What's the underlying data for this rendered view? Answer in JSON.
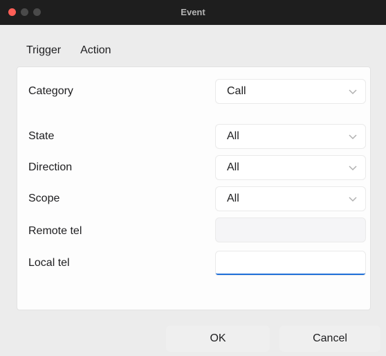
{
  "window": {
    "title": "Event"
  },
  "tabs": [
    {
      "label": "Trigger"
    },
    {
      "label": "Action"
    }
  ],
  "fields": {
    "category": {
      "label": "Category",
      "value": "Call"
    },
    "state": {
      "label": "State",
      "value": "All"
    },
    "direction": {
      "label": "Direction",
      "value": "All"
    },
    "scope": {
      "label": "Scope",
      "value": "All"
    },
    "remote_tel": {
      "label": "Remote tel",
      "value": ""
    },
    "local_tel": {
      "label": "Local tel",
      "value": ""
    }
  },
  "buttons": {
    "ok": "OK",
    "cancel": "Cancel"
  },
  "colors": {
    "accent": "#1e6fd9",
    "close": "#ff5f57"
  }
}
